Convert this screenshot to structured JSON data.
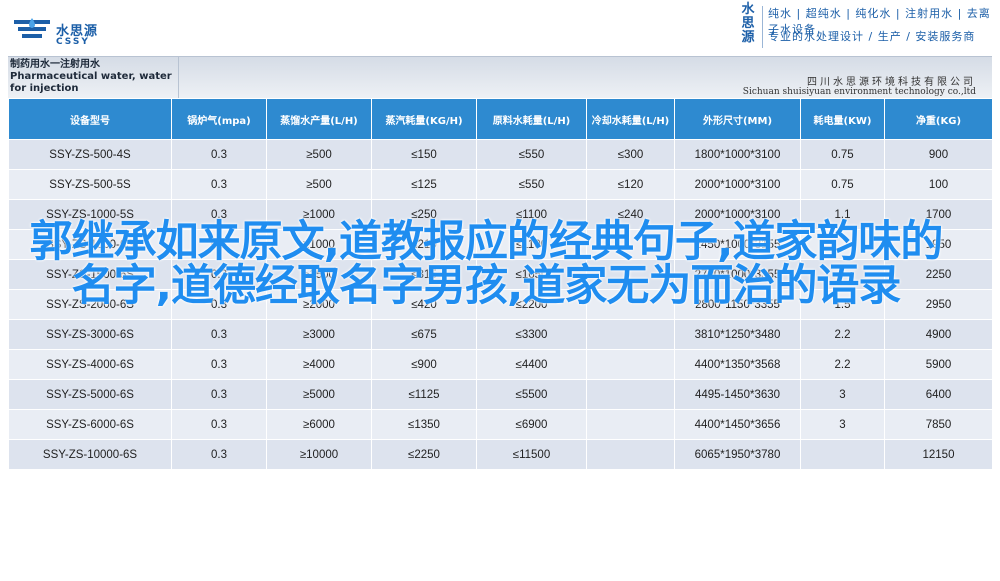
{
  "header": {
    "logo_cn": "水思源",
    "logo_en": "CSSY",
    "brand_vertical": [
      "水",
      "思",
      "源"
    ],
    "tagline_1": "纯水 | 超纯水 | 纯化水 | 注射用水 | 去离子水设备",
    "tagline_2": "专业的水处理设计 / 生产 / 安装服务商"
  },
  "sheet": {
    "product_name": "制药用水一注射用水  Pharmaceutical water, water for injection",
    "company_cn": "四川水思源环境科技有限公司",
    "company_en": "Sichuan shuisiyuan environment technology co.,ltd"
  },
  "table": {
    "headers": [
      "设备型号",
      "锅炉气(mpa)",
      "蒸馏水产量(L/H)",
      "蒸汽耗量(KG/H)",
      "原料水耗量(L/H)",
      "冷却水耗量(L/H)",
      "外形尺寸(MM)",
      "耗电量(KW)",
      "净重(KG)"
    ],
    "rows": [
      [
        "SSY-ZS-500-4S",
        "0.3",
        "≥500",
        "≤150",
        "≤550",
        "≤300",
        "1800*1000*3100",
        "0.75",
        "900"
      ],
      [
        "SSY-ZS-500-5S",
        "0.3",
        "≥500",
        "≤125",
        "≤550",
        "≤120",
        "2000*1000*3100",
        "0.75",
        "100"
      ],
      [
        "SSY-ZS-1000-5S",
        "0.3",
        "≥1000",
        "≤250",
        "≤1100",
        "≤240",
        "2000*1000*3100",
        "1.1",
        "1700"
      ],
      [
        "SSY-ZS-1000-6S",
        "0.3",
        "≥1000",
        "≤210",
        "≤1100",
        "",
        "2450*1000*3155",
        "",
        "1950"
      ],
      [
        "SSY-ZS-1500-6S",
        "0.3",
        "≥1500",
        "≤315",
        "≤1650",
        "",
        "2700*1000*3355",
        "",
        "2250"
      ],
      [
        "SSY-ZS-2000-6S",
        "0.3",
        "≥2000",
        "≤420",
        "≤2200",
        "",
        "2800*1150*3355",
        "1.5",
        "2950"
      ],
      [
        "SSY-ZS-3000-6S",
        "0.3",
        "≥3000",
        "≤675",
        "≤3300",
        "",
        "3810*1250*3480",
        "2.2",
        "4900"
      ],
      [
        "SSY-ZS-4000-6S",
        "0.3",
        "≥4000",
        "≤900",
        "≤4400",
        "",
        "4400*1350*3568",
        "2.2",
        "5900"
      ],
      [
        "SSY-ZS-5000-6S",
        "0.3",
        "≥5000",
        "≤1125",
        "≤5500",
        "",
        "4495-1450*3630",
        "3",
        "6400"
      ],
      [
        "SSY-ZS-6000-6S",
        "0.3",
        "≥6000",
        "≤1350",
        "≤6900",
        "",
        "4400*1450*3656",
        "3",
        "7850"
      ],
      [
        "SSY-ZS-10000-6S",
        "0.3",
        "≥10000",
        "≤2250",
        "≤11500",
        "",
        "6065*1950*3780",
        "",
        "12150"
      ]
    ]
  },
  "overlay": {
    "title": "郭继承如来原文,道教报应的经典句子,道家韵味的名字,道德经取名字男孩,道家无为而治的语录"
  },
  "colors": {
    "brand_blue": "#1c5fa8",
    "header_blue": "#2e8ad0",
    "overlay_blue": "#1f8df0"
  }
}
